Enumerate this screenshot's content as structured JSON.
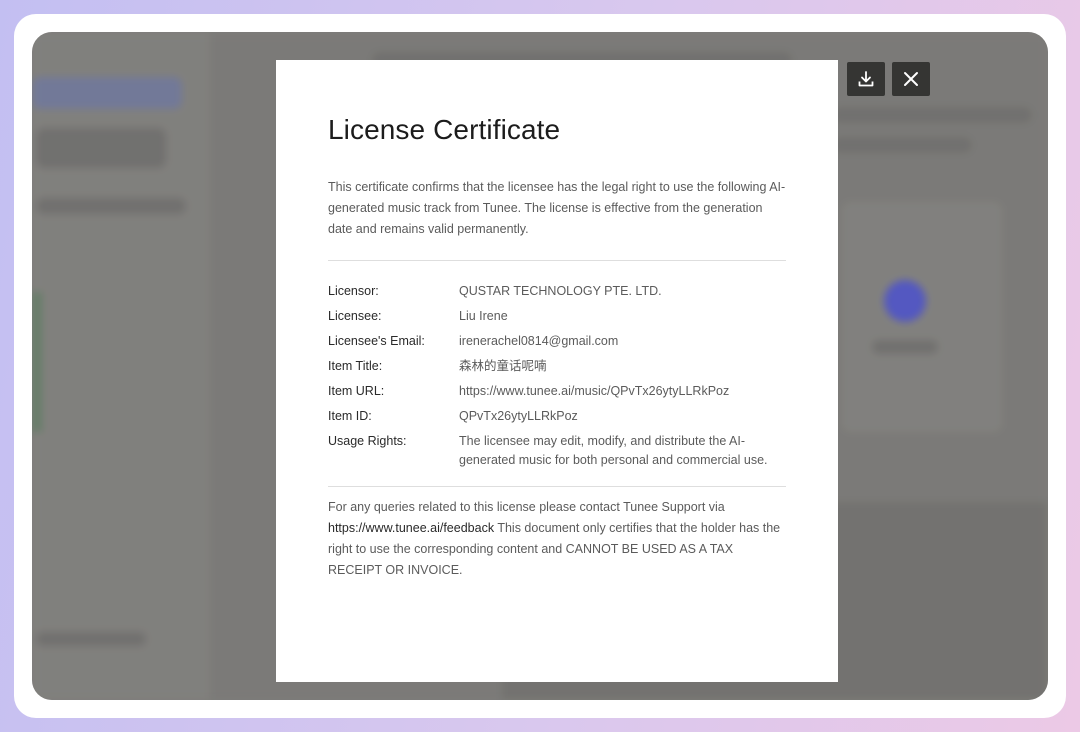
{
  "certificate": {
    "title": "License Certificate",
    "intro": "This certificate confirms that the licensee has the legal right to use the following AI-generated music track from Tunee. The license is effective from the generation date and remains valid permanently.",
    "details": [
      {
        "label": "Licensor:",
        "value": "QUSTAR TECHNOLOGY PTE. LTD."
      },
      {
        "label": "Licensee:",
        "value": "Liu Irene"
      },
      {
        "label": "Licensee's Email:",
        "value": "irenerachel0814@gmail.com"
      },
      {
        "label": "Item Title:",
        "value": "森林的童话呢喃"
      },
      {
        "label": "Item URL:",
        "value": "https://www.tunee.ai/music/QPvTx26ytyLLRkPoz"
      },
      {
        "label": "Item ID:",
        "value": "QPvTx26ytyLLRkPoz"
      },
      {
        "label": "Usage Rights:",
        "value": "The licensee may edit, modify, and distribute the AI-generated music for both personal and commercial use."
      }
    ],
    "footer": {
      "before_link": "For any queries related to this license please contact Tunee Support via ",
      "link": "https://www.tunee.ai/feedback",
      "after_link": " This document only certifies that the holder has the right to use the corresponding content and CANNOT BE USED AS A TAX RECEIPT OR INVOICE."
    }
  },
  "actions": {
    "download_icon": "download-icon",
    "close_icon": "close-icon"
  }
}
